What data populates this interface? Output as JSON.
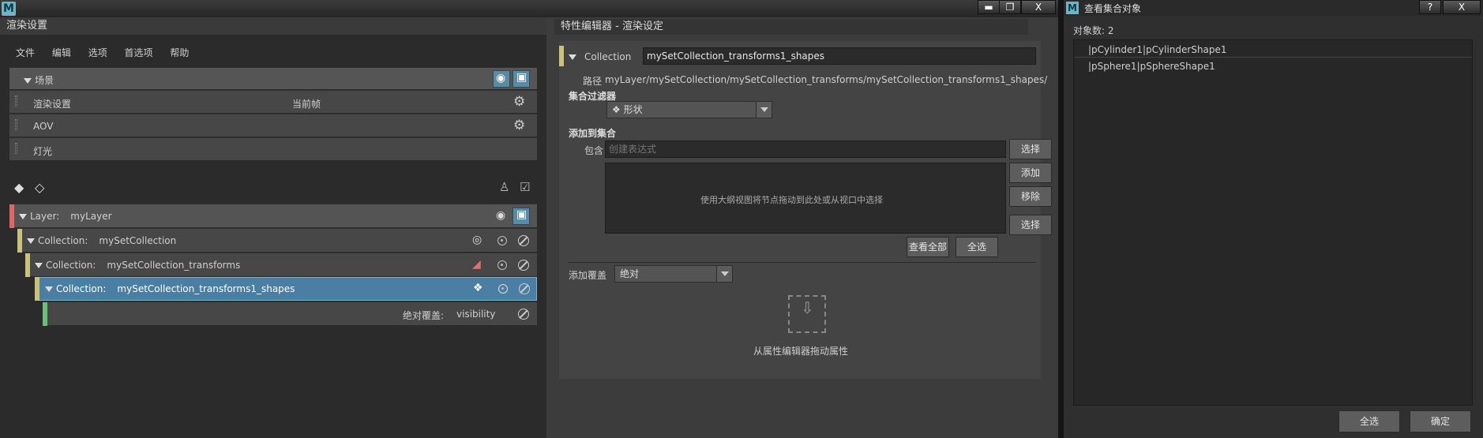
{
  "window": {
    "app_icon": "M",
    "min": "▬",
    "max": "❐",
    "close": "X",
    "help": "?"
  },
  "render_setup": {
    "title": "渲染设置",
    "menu": [
      "文件",
      "编辑",
      "选项",
      "首选项",
      "帮助"
    ],
    "scene": {
      "label": "场景"
    },
    "scene_items": [
      {
        "label": "渲染设置",
        "extra": "当前帧"
      },
      {
        "label": "AOV",
        "extra": ""
      },
      {
        "label": "灯光",
        "extra": ""
      }
    ],
    "layer": {
      "prefix": "Layer:",
      "name": "myLayer"
    },
    "collections": [
      {
        "prefix": "Collection:",
        "name": "mySetCollection"
      },
      {
        "prefix": "Collection:",
        "name": "mySetCollection_transforms"
      },
      {
        "prefix": "Collection:",
        "name": "mySetCollection_transforms1_shapes"
      }
    ],
    "override": {
      "label": "绝对覆盖:",
      "value": "visibility"
    },
    "colors": {
      "layer": "#e06666",
      "collection": "#c9c27a",
      "override": "#6bbf7a",
      "selected": "#4a7ea3"
    }
  },
  "attr_editor": {
    "title": "特性编辑器 - 渲染设定",
    "collection_label": "Collection",
    "collection_name": "mySetCollection_transforms1_shapes",
    "path_label": "路径",
    "path": "myLayer/mySetCollection/mySetCollection_transforms/mySetCollection_transforms1_shapes/",
    "filter_label": "集合过滤器",
    "filter_value": "形状",
    "add_to_collection": "添加到集合",
    "include_label": "包含",
    "include_placeholder": "创建表达式",
    "select_btn": "选择",
    "drop_hint": "使用大纲视图将节点拖动到此处或从视口中选择",
    "add_btn": "添加",
    "remove_btn": "移除",
    "select_btn2": "选择",
    "view_all_btn": "查看全部",
    "select_all_btn": "全选",
    "add_override_label": "添加覆盖",
    "override_type": "绝对",
    "drag_hint": "从属性编辑器拖动属性"
  },
  "view_objects": {
    "title": "查看集合对象",
    "count_label": "对象数: 2",
    "items": [
      "|pCylinder1|pCylinderShape1",
      "|pSphere1|pSphereShape1"
    ],
    "select_all_btn": "全选",
    "ok_btn": "确定"
  }
}
